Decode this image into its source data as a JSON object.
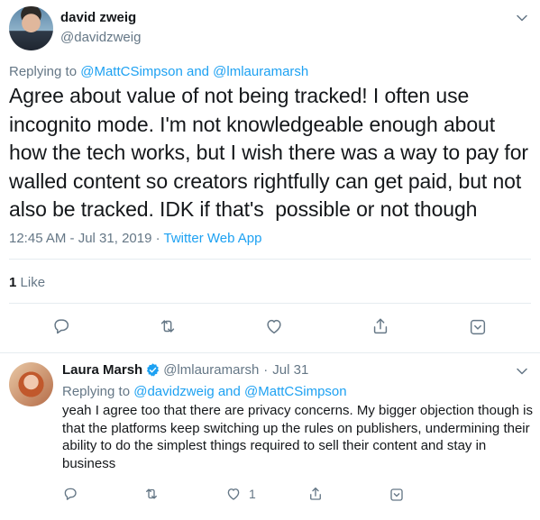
{
  "main_tweet": {
    "author_name": "david zweig",
    "author_handle": "@davidzweig",
    "replying_label": "Replying to",
    "replying_mentions": "@MattCSimpson and @lmlauramarsh",
    "text": "Agree about value of not being tracked! I often use incognito mode. I'm not knowledgeable enough about how the tech works, but I wish there was a way to pay for walled content so creators rightfully can get paid, but not also be tracked. IDK if that's  possible or not though",
    "timestamp": "12:45 AM - Jul 31, 2019",
    "separator": "·",
    "source": "Twitter Web App",
    "like_count": "1",
    "like_label": "Like"
  },
  "reply_tweet": {
    "author_name": "Laura Marsh",
    "author_handle": "@lmlauramarsh",
    "separator": "·",
    "date": "Jul 31",
    "replying_label": "Replying to",
    "replying_mentions": "@davidzweig and @MattCSimpson",
    "text": "yeah I agree too that there are privacy concerns. My bigger objection though is that the platforms keep switching up the rules on publishers, undermining their ability to do the simplest things required to sell their content and stay in business",
    "like_count": "1"
  },
  "colors": {
    "accent": "#1da1f2",
    "muted": "#657786",
    "text": "#14171a",
    "border": "#e6ecf0"
  },
  "icons": [
    "reply-icon",
    "retweet-icon",
    "like-icon",
    "share-icon",
    "chevron-down-icon",
    "verified-badge-icon"
  ]
}
